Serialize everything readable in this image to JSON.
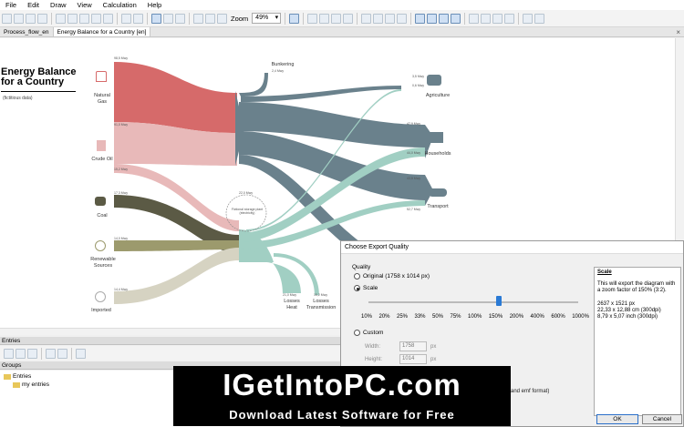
{
  "menu": [
    "File",
    "Edit",
    "Draw",
    "View",
    "Calculation",
    "Help"
  ],
  "toolbar": {
    "zoom_label": "Zoom",
    "zoom_value": "49%"
  },
  "tabs": [
    "Process_flow_en",
    "Energy Balance for a Country [en]"
  ],
  "diagram": {
    "title": "Energy Balance for a Country",
    "subtitle": "(fictitious data)",
    "sources": [
      "Natural Gas",
      "Crude Oil",
      "Coal",
      "Renewable Sources",
      "Imported"
    ],
    "bunkering": "Bunkering",
    "sinks": [
      "Agriculture",
      "Households",
      "Transport"
    ],
    "losses": [
      "Losses Heat",
      "Losses Transmission"
    ],
    "plant_label": "Fictional storage plant (electricity)",
    "values": [
      "98,5 Mwy",
      "91,0 Mwy",
      "15,2 Mwy",
      "17,3 Mwy",
      "14,0 Mwy",
      "14,4 Mwy",
      "2,4 Mwy",
      "3,5 Mwy",
      "0,6 Mwy",
      "47,9 Mwy",
      "44,0 Mwy",
      "43,8 Mwy",
      "52,7 Mwy",
      "22,0 Mwy",
      "21,0 Mwy",
      "15,2 Mwy"
    ]
  },
  "panels": {
    "entries": "Entries",
    "groups": "Groups"
  },
  "tree": {
    "root": "Entries",
    "child": "my entries"
  },
  "dialog": {
    "title": "Choose Export Quality",
    "group": "Quality",
    "original": "Original (1758 x 1014 px)",
    "scale": "Scale",
    "ticks": [
      "10%",
      "20%",
      "25%",
      "33%",
      "50%",
      "75%",
      "100%",
      "150%",
      "200%",
      "400%",
      "600%",
      "1000%"
    ],
    "custom": "Custom",
    "width_label": "Width:",
    "width_value": "1758",
    "width_unit": "px",
    "height_label": "Height:",
    "height_value": "1014",
    "height_unit": "px",
    "emf_fragment": "and emf format)",
    "info_title": "Scale",
    "info_text": "This will export the diagram with a zoom factor of 150% (3:2).",
    "info_px": "2637 x 1521 px",
    "info_cm": "22,33 x 12,88 cm (300dpi)",
    "info_inch": "8,79 x 5,07 inch (300dpi)",
    "ok": "OK",
    "cancel": "Cancel"
  },
  "watermark": {
    "line1": "IGetIntoPC.com",
    "line2": "Download Latest Software for Free"
  },
  "colors": {
    "gas": "#d66a6a",
    "oil": "#e8b9b9",
    "coal": "#5b5a45",
    "renewable": "#9c9a6d",
    "imported": "#d6d3c2",
    "main": "#6a818c",
    "teal": "#a1cfc3",
    "accent": "#2a7ad5"
  }
}
